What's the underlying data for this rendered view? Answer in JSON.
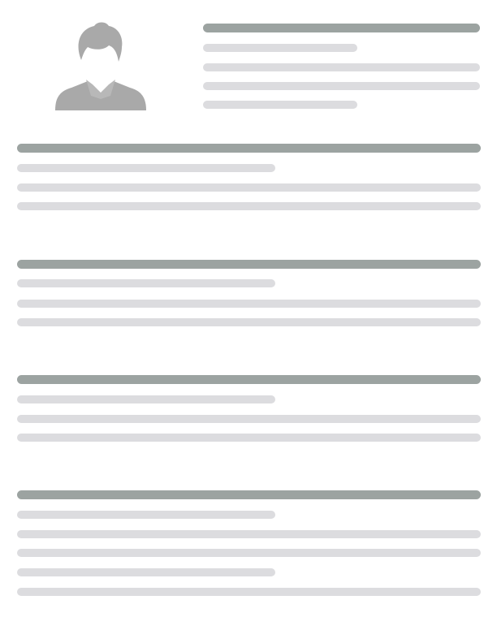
{
  "colors": {
    "background": "#ffffff",
    "header_bar": "#9ca3a1",
    "text_line": "#dcdcdf",
    "avatar": "#a9a9a9"
  },
  "header": {
    "avatar_icon": "person-silhouette-icon"
  },
  "sections": [
    {
      "lines": 3
    },
    {
      "lines": 3
    },
    {
      "lines": 3
    },
    {
      "lines": 5
    }
  ]
}
